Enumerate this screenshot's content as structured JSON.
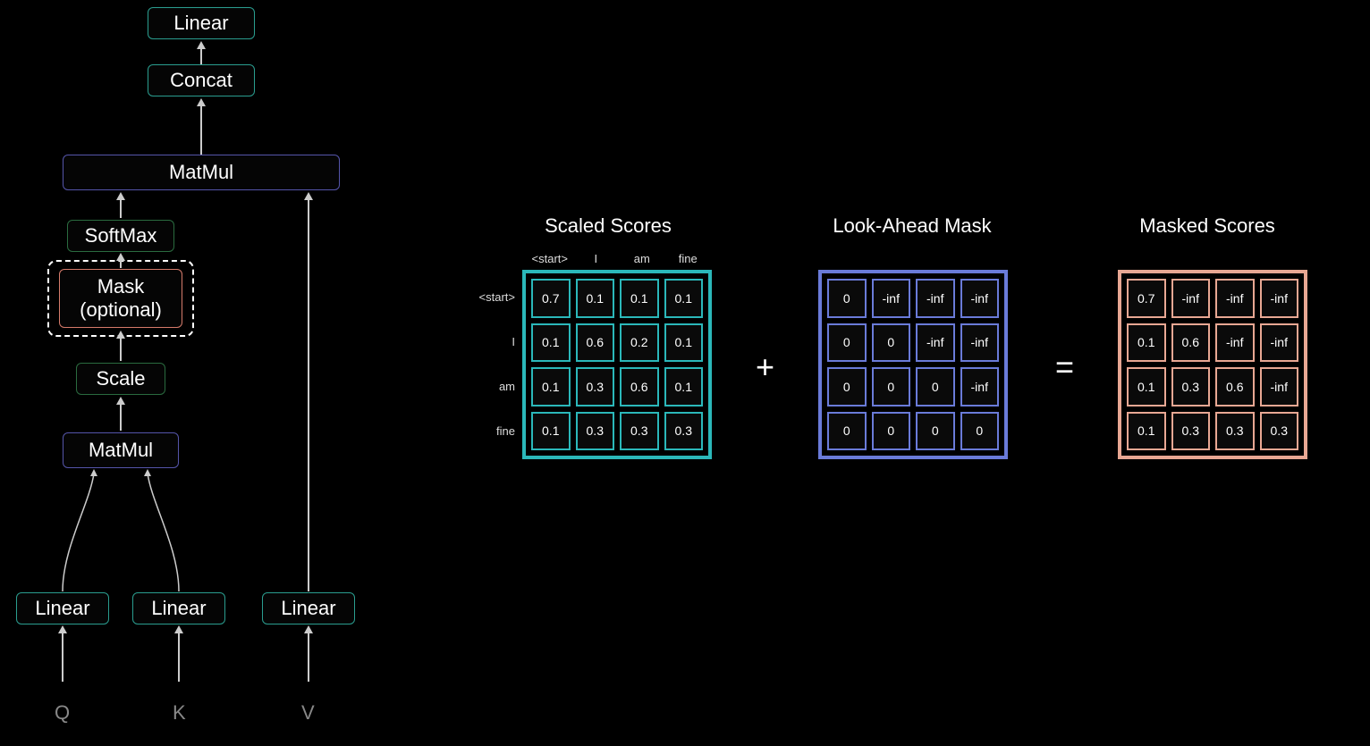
{
  "flow": {
    "linear_top": "Linear",
    "concat": "Concat",
    "matmul_top": "MatMul",
    "softmax": "SoftMax",
    "mask": "Mask\n(optional)",
    "scale": "Scale",
    "matmul_bottom": "MatMul",
    "linear_q": "Linear",
    "linear_k": "Linear",
    "linear_v": "Linear",
    "q": "Q",
    "k": "K",
    "v": "V"
  },
  "titles": {
    "scaled": "Scaled Scores",
    "mask": "Look-Ahead Mask",
    "masked": "Masked Scores"
  },
  "ops": {
    "plus": "+",
    "equals": "="
  },
  "tokens": [
    "<start>",
    "I",
    "am",
    "fine"
  ],
  "matrices": {
    "scaled": [
      [
        "0.7",
        "0.1",
        "0.1",
        "0.1"
      ],
      [
        "0.1",
        "0.6",
        "0.2",
        "0.1"
      ],
      [
        "0.1",
        "0.3",
        "0.6",
        "0.1"
      ],
      [
        "0.1",
        "0.3",
        "0.3",
        "0.3"
      ]
    ],
    "lookahead": [
      [
        "0",
        "-inf",
        "-inf",
        "-inf"
      ],
      [
        "0",
        "0",
        "-inf",
        "-inf"
      ],
      [
        "0",
        "0",
        "0",
        "-inf"
      ],
      [
        "0",
        "0",
        "0",
        "0"
      ]
    ],
    "masked": [
      [
        "0.7",
        "-inf",
        "-inf",
        "-inf"
      ],
      [
        "0.1",
        "0.6",
        "-inf",
        "-inf"
      ],
      [
        "0.1",
        "0.3",
        "0.6",
        "-inf"
      ],
      [
        "0.1",
        "0.3",
        "0.3",
        "0.3"
      ]
    ]
  },
  "colors": {
    "teal": "#2a9d8f",
    "green": "#2a6b3f",
    "purple": "#5555aa",
    "salmon": "#d67b6b",
    "cyan_matrix": "#2bb8ba",
    "blue_matrix": "#6a7bd9",
    "salmon_matrix": "#e8a793"
  }
}
